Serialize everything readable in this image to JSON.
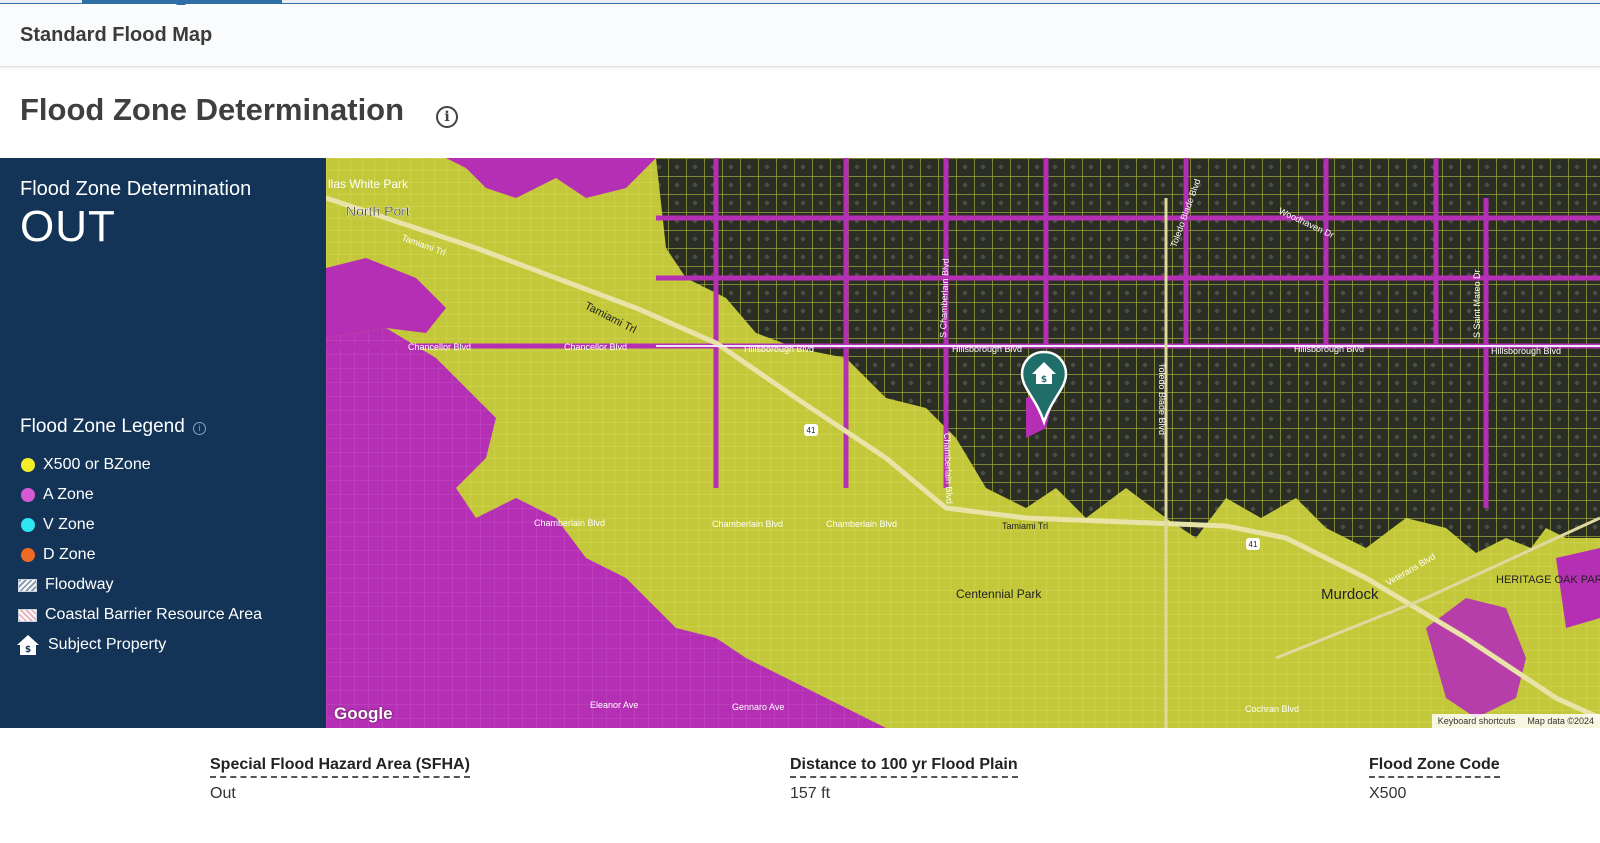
{
  "tab": {
    "title": "Standard Flood Map"
  },
  "page": {
    "title": "Flood Zone Determination"
  },
  "determination": {
    "label": "Flood Zone Determination",
    "value": "OUT"
  },
  "legend": {
    "title": "Flood Zone Legend",
    "items": [
      {
        "label": "X500 or BZone",
        "color": "#f2ee2a"
      },
      {
        "label": "A Zone",
        "color": "#d75ad5"
      },
      {
        "label": "V Zone",
        "color": "#2ee6f2"
      },
      {
        "label": "D Zone",
        "color": "#ef6a24"
      },
      {
        "label": "Floodway",
        "icon": "hatch-swatch-icon"
      },
      {
        "label": "Coastal Barrier Resource Area",
        "icon": "crosshatch-swatch-icon"
      },
      {
        "label": "Subject Property",
        "icon": "house-icon"
      }
    ]
  },
  "map": {
    "colors": {
      "a_zone": "#b52fb5",
      "x500": "#c8cd3c",
      "dark": "#26291f",
      "road": "#e8e4a8",
      "pin": "#1f6e6a"
    },
    "labels": {
      "north_port": "North Port",
      "park_top": "llas White Park",
      "tamiami_1": "Tamiami Trl",
      "tamiami_2": "Tamiami Trl",
      "tamiami_3": "Tamiami Trl",
      "hillsborough_1": "Hillsborough Blvd",
      "hillsborough_2": "Hillsborough Blvd",
      "hillsborough_3": "Hillsborough Blvd",
      "hillsborough_4": "Hillsborough Blvd",
      "chancellor_1": "Chancellor Blvd",
      "chancellor_2": "Chancellor Blvd",
      "chamberlain_1": "Chamberlain Blvd",
      "chamberlain_2": "Chamberlain Blvd",
      "chamberlain_3": "Chamberlain Blvd",
      "chamberlain_v1": "S Chamberlain Blvd",
      "chamberlain_v2": "Chamberlain Blvd",
      "toledo_1": "Toledo Blade Blvd",
      "toledo_2": "Toledo Blade Blvd",
      "woodhaven": "Woodhaven Dr",
      "saint_mateo": "S Saint Mateo Dr",
      "centennial": "Centennial Park",
      "murdock": "Murdock",
      "heritage": "HERITAGE OAK PARK",
      "veterans": "Veterans Blvd",
      "eleanor": "Eleanor Ave",
      "gennaro": "Gennaro Ave",
      "cochran": "Cochran Blvd",
      "highway": "41",
      "google": "Google",
      "shortcuts": "Keyboard shortcuts",
      "mapdata": "Map data ©2024"
    }
  },
  "metrics": [
    {
      "label": "Special Flood Hazard Area (SFHA)",
      "value": "Out"
    },
    {
      "label": "Distance to 100 yr Flood Plain",
      "value": "157 ft"
    },
    {
      "label": "Flood Zone Code",
      "value": "X500"
    }
  ]
}
